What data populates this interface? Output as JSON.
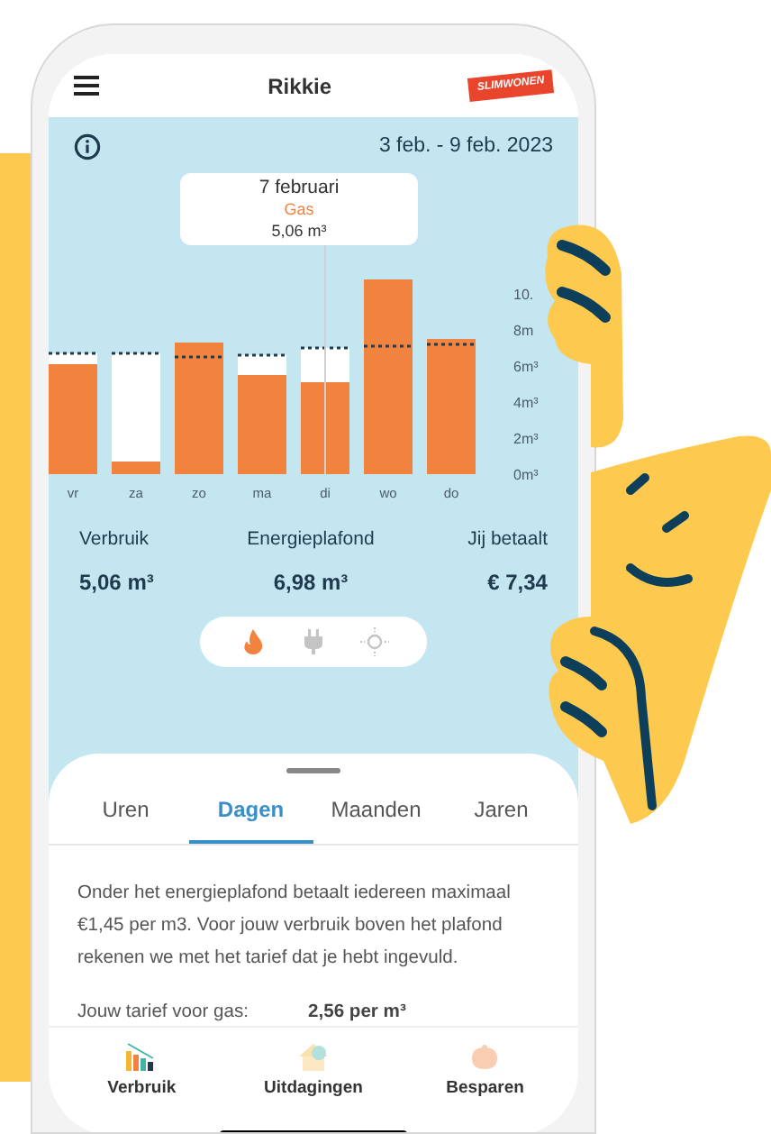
{
  "header": {
    "title": "Rikkie",
    "logo_text": "SLIMWONEN"
  },
  "period": "3 feb. - 9 feb. 2023",
  "chart": {
    "chart_data": {
      "type": "bar",
      "categories": [
        "vr",
        "za",
        "zo",
        "ma",
        "di",
        "wo",
        "do"
      ],
      "stacked": true,
      "series": [
        {
          "color": "#f2833f",
          "values": [
            6.1,
            0.7,
            6.5,
            5.5,
            5.1,
            7.1,
            7.2
          ]
        },
        {
          "color": "#ffffff",
          "values": [
            0.6,
            6.0,
            0,
            1.1,
            1.9,
            0,
            0
          ]
        },
        {
          "color": "#f2833f",
          "values": [
            0,
            0,
            0.8,
            0,
            0,
            3.7,
            0.3
          ]
        }
      ],
      "ylim": [
        0,
        10.9
      ],
      "yticks": [
        {
          "value": 0,
          "label": "0m³"
        },
        {
          "value": 2,
          "label": "2m³"
        },
        {
          "value": 4,
          "label": "4m³"
        },
        {
          "value": 6,
          "label": "6m³"
        },
        {
          "value": 8,
          "label": "8m"
        },
        {
          "value": 10,
          "label": "10."
        }
      ]
    },
    "day_selected": [
      false,
      false,
      false,
      false,
      true,
      false,
      false
    ],
    "tooltip": {
      "date": "7 februari",
      "label": "Gas",
      "value": "5,06 m³"
    }
  },
  "summary": [
    {
      "label": "Verbruik",
      "value": "5,06 m³"
    },
    {
      "label": "Energieplafond",
      "value": "6,98 m³"
    },
    {
      "label": "Jij betaalt",
      "value": "€ 7,34"
    }
  ],
  "energy_toggle": [
    {
      "kind": "gas",
      "selected": true
    },
    {
      "kind": "electricity",
      "selected": false
    },
    {
      "kind": "solar",
      "selected": false
    }
  ],
  "tabs": [
    {
      "label": "Uren",
      "selected": false
    },
    {
      "label": "Dagen",
      "selected": true
    },
    {
      "label": "Maanden",
      "selected": false
    },
    {
      "label": "Jaren",
      "selected": false
    }
  ],
  "description": "Onder het energieplafond betaalt iedereen maximaal €1,45 per m3. Voor jouw verbruik boven het plafond rekenen we met het tarief dat je hebt ingevuld.",
  "tariff": {
    "label": "Jouw tarief voor gas:",
    "value": "2,56 per m³"
  },
  "bottom_nav": [
    {
      "kind": "usage",
      "label": "Verbruik",
      "selected": true
    },
    {
      "kind": "challenges",
      "label": "Uitdagingen",
      "selected": false
    },
    {
      "kind": "savings",
      "label": "Besparen",
      "selected": false
    }
  ]
}
